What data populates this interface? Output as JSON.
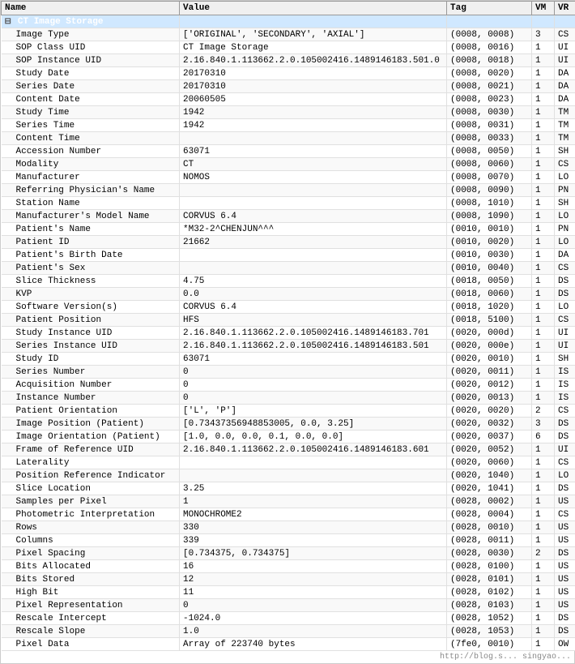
{
  "header": {
    "col_name": "Name",
    "col_value": "Value",
    "col_tag": "Tag",
    "col_vm": "VM",
    "col_vr": "VR"
  },
  "rows": [
    {
      "type": "group",
      "name": "CT Image Storage",
      "value": "",
      "tag": "",
      "vm": "",
      "vr": "",
      "highlight": true
    },
    {
      "type": "data",
      "indent": 1,
      "name": "Image Type",
      "value": "['ORIGINAL', 'SECONDARY', 'AXIAL']",
      "tag": "(0008, 0008)",
      "vm": "3",
      "vr": "CS"
    },
    {
      "type": "data",
      "indent": 1,
      "name": "SOP Class UID",
      "value": "CT Image Storage",
      "tag": "(0008, 0016)",
      "vm": "1",
      "vr": "UI"
    },
    {
      "type": "data",
      "indent": 1,
      "name": "SOP Instance UID",
      "value": "2.16.840.1.113662.2.0.105002416.1489146183.501.0",
      "tag": "(0008, 0018)",
      "vm": "1",
      "vr": "UI"
    },
    {
      "type": "data",
      "indent": 1,
      "name": "Study Date",
      "value": "20170310",
      "tag": "(0008, 0020)",
      "vm": "1",
      "vr": "DA"
    },
    {
      "type": "data",
      "indent": 1,
      "name": "Series Date",
      "value": "20170310",
      "tag": "(0008, 0021)",
      "vm": "1",
      "vr": "DA"
    },
    {
      "type": "data",
      "indent": 1,
      "name": "Content Date",
      "value": "20060505",
      "tag": "(0008, 0023)",
      "vm": "1",
      "vr": "DA"
    },
    {
      "type": "data",
      "indent": 1,
      "name": "Study Time",
      "value": "1942",
      "tag": "(0008, 0030)",
      "vm": "1",
      "vr": "TM"
    },
    {
      "type": "data",
      "indent": 1,
      "name": "Series Time",
      "value": "1942",
      "tag": "(0008, 0031)",
      "vm": "1",
      "vr": "TM"
    },
    {
      "type": "data",
      "indent": 1,
      "name": "Content Time",
      "value": "",
      "tag": "(0008, 0033)",
      "vm": "1",
      "vr": "TM"
    },
    {
      "type": "data",
      "indent": 1,
      "name": "Accession Number",
      "value": "63071",
      "tag": "(0008, 0050)",
      "vm": "1",
      "vr": "SH"
    },
    {
      "type": "data",
      "indent": 1,
      "name": "Modality",
      "value": "CT",
      "tag": "(0008, 0060)",
      "vm": "1",
      "vr": "CS"
    },
    {
      "type": "data",
      "indent": 1,
      "name": "Manufacturer",
      "value": "NOMOS",
      "tag": "(0008, 0070)",
      "vm": "1",
      "vr": "LO"
    },
    {
      "type": "data",
      "indent": 1,
      "name": "Referring Physician's Name",
      "value": "",
      "tag": "(0008, 0090)",
      "vm": "1",
      "vr": "PN"
    },
    {
      "type": "data",
      "indent": 1,
      "name": "Station Name",
      "value": "",
      "tag": "(0008, 1010)",
      "vm": "1",
      "vr": "SH"
    },
    {
      "type": "data",
      "indent": 1,
      "name": "Manufacturer's Model Name",
      "value": "CORVUS 6.4",
      "tag": "(0008, 1090)",
      "vm": "1",
      "vr": "LO"
    },
    {
      "type": "data",
      "indent": 1,
      "name": "Patient's Name",
      "value": "*M32-2^CHENJUN^^^",
      "tag": "(0010, 0010)",
      "vm": "1",
      "vr": "PN"
    },
    {
      "type": "data",
      "indent": 1,
      "name": "Patient ID",
      "value": "21662",
      "tag": "(0010, 0020)",
      "vm": "1",
      "vr": "LO"
    },
    {
      "type": "data",
      "indent": 1,
      "name": "Patient's Birth Date",
      "value": "",
      "tag": "(0010, 0030)",
      "vm": "1",
      "vr": "DA"
    },
    {
      "type": "data",
      "indent": 1,
      "name": "Patient's Sex",
      "value": "",
      "tag": "(0010, 0040)",
      "vm": "1",
      "vr": "CS"
    },
    {
      "type": "data",
      "indent": 1,
      "name": "Slice Thickness",
      "value": "4.75",
      "tag": "(0018, 0050)",
      "vm": "1",
      "vr": "DS"
    },
    {
      "type": "data",
      "indent": 1,
      "name": "KVP",
      "value": "0.0",
      "tag": "(0018, 0060)",
      "vm": "1",
      "vr": "DS"
    },
    {
      "type": "data",
      "indent": 1,
      "name": "Software Version(s)",
      "value": "CORVUS 6.4",
      "tag": "(0018, 1020)",
      "vm": "1",
      "vr": "LO"
    },
    {
      "type": "data",
      "indent": 1,
      "name": "Patient Position",
      "value": "HFS",
      "tag": "(0018, 5100)",
      "vm": "1",
      "vr": "CS"
    },
    {
      "type": "data",
      "indent": 1,
      "name": "Study Instance UID",
      "value": "2.16.840.1.113662.2.0.105002416.1489146183.701",
      "tag": "(0020, 000d)",
      "vm": "1",
      "vr": "UI"
    },
    {
      "type": "data",
      "indent": 1,
      "name": "Series Instance UID",
      "value": "2.16.840.1.113662.2.0.105002416.1489146183.501",
      "tag": "(0020, 000e)",
      "vm": "1",
      "vr": "UI"
    },
    {
      "type": "data",
      "indent": 1,
      "name": "Study ID",
      "value": "63071",
      "tag": "(0020, 0010)",
      "vm": "1",
      "vr": "SH"
    },
    {
      "type": "data",
      "indent": 1,
      "name": "Series Number",
      "value": "0",
      "tag": "(0020, 0011)",
      "vm": "1",
      "vr": "IS"
    },
    {
      "type": "data",
      "indent": 1,
      "name": "Acquisition Number",
      "value": "0",
      "tag": "(0020, 0012)",
      "vm": "1",
      "vr": "IS"
    },
    {
      "type": "data",
      "indent": 1,
      "name": "Instance Number",
      "value": "0",
      "tag": "(0020, 0013)",
      "vm": "1",
      "vr": "IS"
    },
    {
      "type": "data",
      "indent": 1,
      "name": "Patient Orientation",
      "value": "['L', 'P']",
      "tag": "(0020, 0020)",
      "vm": "2",
      "vr": "CS"
    },
    {
      "type": "data",
      "indent": 1,
      "name": "Image Position (Patient)",
      "value": "[0.73437356948853005, 0.0, 3.25]",
      "tag": "(0020, 0032)",
      "vm": "3",
      "vr": "DS"
    },
    {
      "type": "data",
      "indent": 1,
      "name": "Image Orientation (Patient)",
      "value": "[1.0, 0.0, 0.0, 0.1, 0.0, 0.0]",
      "tag": "(0020, 0037)",
      "vm": "6",
      "vr": "DS"
    },
    {
      "type": "data",
      "indent": 1,
      "name": "Frame of Reference UID",
      "value": "2.16.840.1.113662.2.0.105002416.1489146183.601",
      "tag": "(0020, 0052)",
      "vm": "1",
      "vr": "UI"
    },
    {
      "type": "data",
      "indent": 1,
      "name": "Laterality",
      "value": "",
      "tag": "(0020, 0060)",
      "vm": "1",
      "vr": "CS"
    },
    {
      "type": "data",
      "indent": 1,
      "name": "Position Reference Indicator",
      "value": "",
      "tag": "(0020, 1040)",
      "vm": "1",
      "vr": "LO"
    },
    {
      "type": "data",
      "indent": 1,
      "name": "Slice Location",
      "value": "3.25",
      "tag": "(0020, 1041)",
      "vm": "1",
      "vr": "DS"
    },
    {
      "type": "data",
      "indent": 1,
      "name": "Samples per Pixel",
      "value": "1",
      "tag": "(0028, 0002)",
      "vm": "1",
      "vr": "US"
    },
    {
      "type": "data",
      "indent": 1,
      "name": "Photometric Interpretation",
      "value": "MONOCHROME2",
      "tag": "(0028, 0004)",
      "vm": "1",
      "vr": "CS"
    },
    {
      "type": "data",
      "indent": 1,
      "name": "Rows",
      "value": "330",
      "tag": "(0028, 0010)",
      "vm": "1",
      "vr": "US"
    },
    {
      "type": "data",
      "indent": 1,
      "name": "Columns",
      "value": "339",
      "tag": "(0028, 0011)",
      "vm": "1",
      "vr": "US"
    },
    {
      "type": "data",
      "indent": 1,
      "name": "Pixel Spacing",
      "value": "[0.734375, 0.734375]",
      "tag": "(0028, 0030)",
      "vm": "2",
      "vr": "DS"
    },
    {
      "type": "data",
      "indent": 1,
      "name": "Bits Allocated",
      "value": "16",
      "tag": "(0028, 0100)",
      "vm": "1",
      "vr": "US"
    },
    {
      "type": "data",
      "indent": 1,
      "name": "Bits Stored",
      "value": "12",
      "tag": "(0028, 0101)",
      "vm": "1",
      "vr": "US"
    },
    {
      "type": "data",
      "indent": 1,
      "name": "High Bit",
      "value": "11",
      "tag": "(0028, 0102)",
      "vm": "1",
      "vr": "US"
    },
    {
      "type": "data",
      "indent": 1,
      "name": "Pixel Representation",
      "value": "0",
      "tag": "(0028, 0103)",
      "vm": "1",
      "vr": "US"
    },
    {
      "type": "data",
      "indent": 1,
      "name": "Rescale Intercept",
      "value": "-1024.0",
      "tag": "(0028, 1052)",
      "vm": "1",
      "vr": "DS"
    },
    {
      "type": "data",
      "indent": 1,
      "name": "Rescale Slope",
      "value": "1.0",
      "tag": "(0028, 1053)",
      "vm": "1",
      "vr": "DS"
    },
    {
      "type": "data",
      "indent": 1,
      "name": "Pixel Data",
      "value": "Array of 223740 bytes",
      "tag": "(7fe0, 0010)",
      "vm": "1",
      "vr": "OW"
    }
  ],
  "watermark": "http://blog.s... singyao..."
}
